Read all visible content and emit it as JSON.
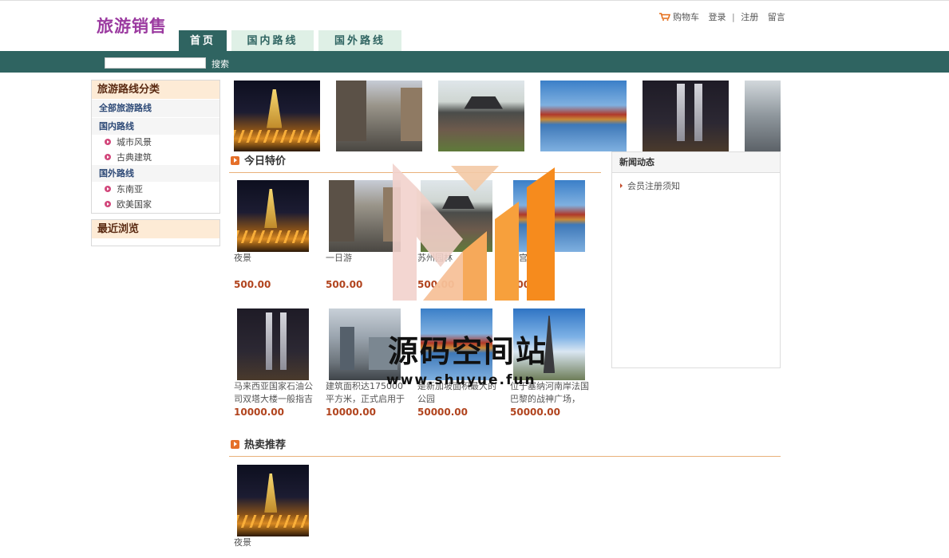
{
  "header": {
    "logo": "旅游销售",
    "cart": "购物车",
    "login": "登录",
    "separator": "|",
    "register": "注册",
    "message": "留言"
  },
  "nav": {
    "tabs": [
      "首页",
      "国内路线",
      "国外路线"
    ],
    "active_index": 0
  },
  "search": {
    "value": "",
    "button": "搜索"
  },
  "sidebar": {
    "categories_title": "旅游路线分类",
    "all_routes": "全部旅游路线",
    "domestic": "国内路线",
    "domestic_items": [
      "城市风景",
      "古典建筑"
    ],
    "foreign": "国外路线",
    "foreign_items": [
      "东南亚",
      "欧美国家"
    ],
    "recent_title": "最近浏览"
  },
  "banner": {
    "photos": [
      "night-city",
      "street",
      "garden",
      "palace",
      "twin-towers",
      "modern-building"
    ]
  },
  "today_special": {
    "title": "今日特价",
    "products": [
      {
        "name": "夜景",
        "price": "500.00",
        "photo": "night-city"
      },
      {
        "name": "一日游",
        "price": "500.00",
        "photo": "street"
      },
      {
        "name": "苏州园林",
        "price": "500.00",
        "photo": "garden"
      },
      {
        "name": "故宫一日游",
        "price": "500.00",
        "photo": "palace"
      },
      {
        "name": "马来西亚国家石油公司双塔大楼一般指吉",
        "price": "10000.00",
        "photo": "twin-towers"
      },
      {
        "name": "建筑面积达175000平方米，正式启用于",
        "price": "10000.00",
        "photo": "modern-building"
      },
      {
        "name": "是新加坡面积最大的公园",
        "price": "50000.00",
        "photo": "park"
      },
      {
        "name": "位于塞纳河南岸法国巴黎的战神广场，",
        "price": "50000.00",
        "photo": "paris"
      }
    ]
  },
  "news": {
    "title": "新闻动态",
    "items": [
      "会员注册须知"
    ]
  },
  "hot": {
    "title": "热卖推荐",
    "products": [
      {
        "name": "夜景",
        "photo": "night-city"
      }
    ]
  },
  "watermark": {
    "text": "源码空间站",
    "url": "www.shuyue.fun"
  },
  "colors": {
    "primary": "#2f6461",
    "logo": "#9b3aa0",
    "price": "#b1441e",
    "accent_line": "#e9b17a"
  }
}
